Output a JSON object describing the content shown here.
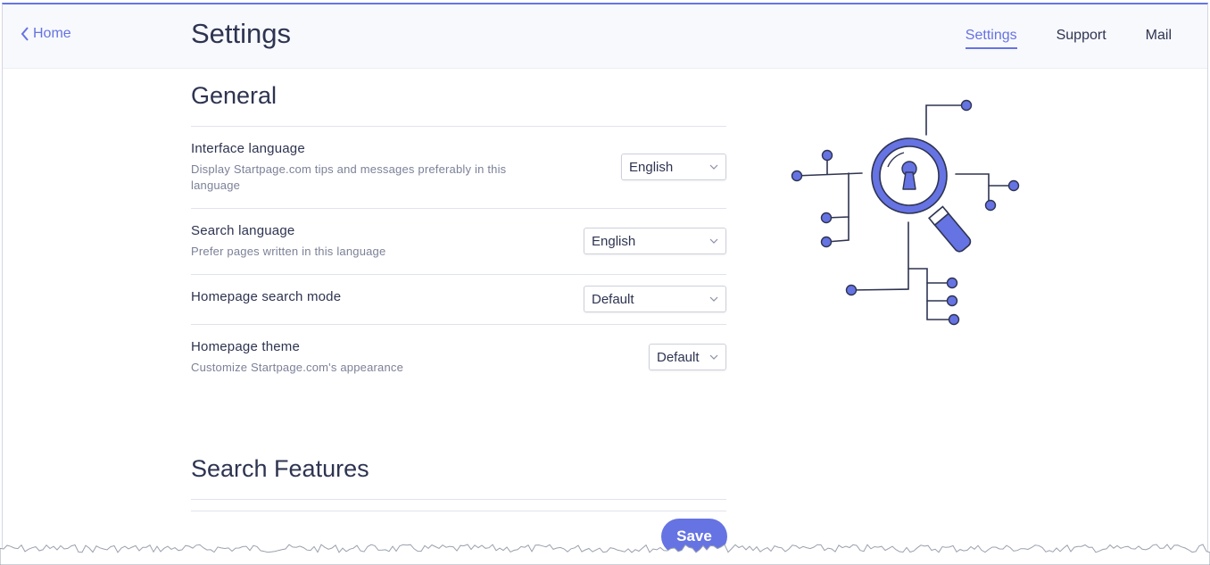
{
  "header": {
    "back_label": "Home",
    "title": "Settings",
    "nav": [
      {
        "label": "Settings",
        "active": true
      },
      {
        "label": "Support",
        "active": false
      },
      {
        "label": "Mail",
        "active": false
      }
    ]
  },
  "general": {
    "title": "General",
    "settings": [
      {
        "label": "Interface language",
        "description": "Display Startpage.com tips and messages preferably in this language",
        "value": "English"
      },
      {
        "label": "Search language",
        "description": "Prefer pages written in this language",
        "value": "English"
      },
      {
        "label": "Homepage search mode",
        "description": "",
        "value": "Default"
      },
      {
        "label": "Homepage theme",
        "description": "Customize Startpage.com's appearance",
        "value": "Default"
      }
    ]
  },
  "search_features": {
    "title": "Search Features"
  },
  "save_label": "Save",
  "icons": {
    "back": "chevron-left-icon",
    "select": "chevron-down-icon",
    "illustration": "magnifier-keyhole-network-illustration"
  },
  "colors": {
    "accent": "#6573e3",
    "text": "#2e3451",
    "muted": "#7c8198",
    "header_bg": "#f8f9fd"
  }
}
